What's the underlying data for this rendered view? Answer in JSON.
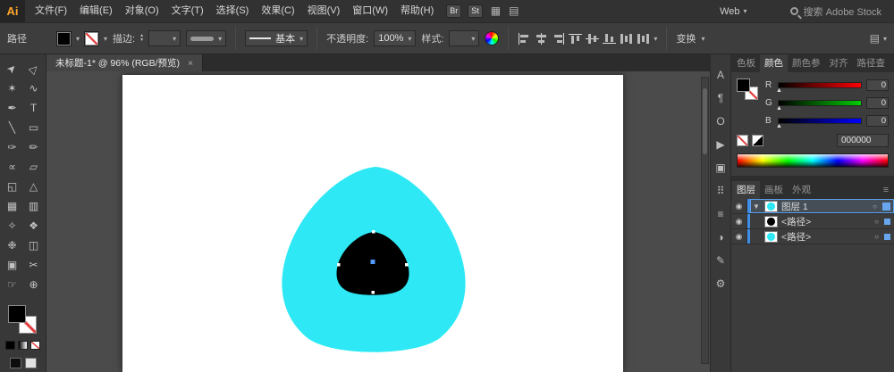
{
  "app": {
    "logo_text": "Ai"
  },
  "glyphs": {
    "caret": "▾",
    "close": "×",
    "eye": "◉",
    "disclosure": "▼",
    "target": "○",
    "menu": "≡",
    "spin_up": "▴",
    "spin_down": "▾",
    "slider_marker": "▲",
    "arrange_icon": "▦",
    "layout_icon": "▤"
  },
  "menubar": {
    "items": [
      "文件(F)",
      "编辑(E)",
      "对象(O)",
      "文字(T)",
      "选择(S)",
      "效果(C)",
      "视图(V)",
      "窗口(W)",
      "帮助(H)"
    ],
    "badges": {
      "bridge": "Br",
      "stock": "St"
    },
    "workspace": {
      "label": "Web"
    },
    "search": {
      "text": "搜索 Adobe Stock"
    }
  },
  "controlbar": {
    "context_label": "路径",
    "stroke_label": "描边:",
    "brush_value": "基本",
    "opacity_label": "不透明度:",
    "opacity_value": "100%",
    "style_label": "样式:",
    "transform_label": "变换"
  },
  "tabbar": {
    "doc_title": "未标题-1* @ 96% (RGB/预览)"
  },
  "toolbar": {
    "tools": [
      {
        "name": "selection",
        "glyph": "➤"
      },
      {
        "name": "direct-selection",
        "glyph": "▷"
      },
      {
        "name": "magic-wand",
        "glyph": "✶"
      },
      {
        "name": "lasso",
        "glyph": "∿"
      },
      {
        "name": "pen",
        "glyph": "✒"
      },
      {
        "name": "type",
        "glyph": "T"
      },
      {
        "name": "line-segment",
        "glyph": "╲"
      },
      {
        "name": "rectangle",
        "glyph": "▭"
      },
      {
        "name": "paintbrush",
        "glyph": "✑"
      },
      {
        "name": "pencil",
        "glyph": "✏"
      },
      {
        "name": "width",
        "glyph": "∝"
      },
      {
        "name": "free-transform",
        "glyph": "▱"
      },
      {
        "name": "shape-builder",
        "glyph": "◱"
      },
      {
        "name": "perspective-grid",
        "glyph": "△"
      },
      {
        "name": "mesh",
        "glyph": "▦"
      },
      {
        "name": "gradient",
        "glyph": "▥"
      },
      {
        "name": "eyedropper",
        "glyph": "✧"
      },
      {
        "name": "blend",
        "glyph": "❖"
      },
      {
        "name": "symbol-sprayer",
        "glyph": "❉"
      },
      {
        "name": "column-graph",
        "glyph": "◫"
      },
      {
        "name": "artboard",
        "glyph": "▣"
      },
      {
        "name": "slice",
        "glyph": "✂"
      },
      {
        "name": "hand",
        "glyph": "☞"
      },
      {
        "name": "zoom",
        "glyph": "⊕"
      }
    ]
  },
  "artwork": {
    "artboard_color": "#ffffff",
    "cyan_fill": "#2ee9f5",
    "black_fill": "#000000",
    "anchor_selected": "#4f9bfa",
    "anchor_unselected": "#ffffff"
  },
  "panel_strip": {
    "icons": [
      {
        "name": "character",
        "glyph": "A"
      },
      {
        "name": "paragraph",
        "glyph": "¶"
      },
      {
        "name": "opentype",
        "glyph": "O"
      },
      {
        "name": "actions",
        "glyph": "▶"
      },
      {
        "name": "artboards",
        "glyph": "▣"
      },
      {
        "name": "transform",
        "glyph": "⠿"
      },
      {
        "name": "align",
        "glyph": "≡"
      },
      {
        "name": "transparency",
        "glyph": "◑"
      },
      {
        "name": "appearance",
        "glyph": "✎"
      },
      {
        "name": "graphic-styles",
        "glyph": "⚙"
      }
    ]
  },
  "color_panel": {
    "tabs": [
      "色板",
      "颜色",
      "颜色参",
      "对齐",
      "路径查"
    ],
    "channels": [
      {
        "label": "R",
        "value": "0"
      },
      {
        "label": "G",
        "value": "0"
      },
      {
        "label": "B",
        "value": "0"
      }
    ],
    "hex_value": "000000"
  },
  "layers_panel": {
    "tabs": [
      "图层",
      "画板",
      "外观"
    ],
    "rows": [
      {
        "label": "图层 1"
      },
      {
        "label": "<路径>"
      },
      {
        "label": "<路径>"
      }
    ]
  }
}
